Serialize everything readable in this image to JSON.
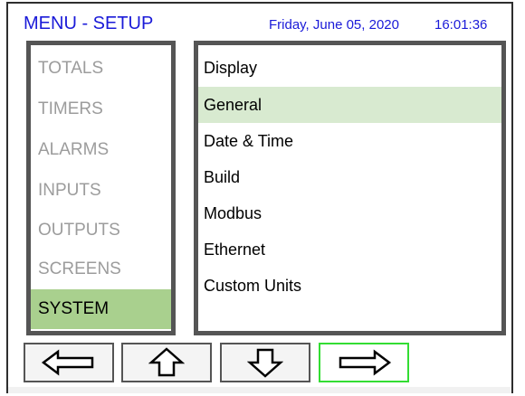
{
  "header": {
    "title": "MENU - SETUP",
    "date": "Friday, June 05, 2020",
    "time": "16:01:36"
  },
  "left_menu": {
    "items": [
      {
        "label": "TOTALS"
      },
      {
        "label": "TIMERS"
      },
      {
        "label": "ALARMS"
      },
      {
        "label": "INPUTS"
      },
      {
        "label": "OUTPUTS"
      },
      {
        "label": "SCREENS"
      },
      {
        "label": "SYSTEM"
      }
    ],
    "selected": "SYSTEM"
  },
  "right_menu": {
    "items": [
      {
        "label": "Display"
      },
      {
        "label": "General"
      },
      {
        "label": "Date & Time"
      },
      {
        "label": "Build"
      },
      {
        "label": "Modbus"
      },
      {
        "label": "Ethernet"
      },
      {
        "label": "Custom Units"
      }
    ],
    "selected": "General"
  },
  "nav": {
    "buttons": [
      {
        "icon": "arrow-left-icon"
      },
      {
        "icon": "arrow-up-icon"
      },
      {
        "icon": "arrow-down-icon"
      },
      {
        "icon": "arrow-right-icon"
      }
    ],
    "active": "arrow-right-icon"
  },
  "colors": {
    "title_blue": "#1a1ad8",
    "selected_green": "#a9d08e",
    "highlight_light_green": "#d8ead0",
    "active_border_green": "#33dd33",
    "panel_border": "#555555"
  }
}
